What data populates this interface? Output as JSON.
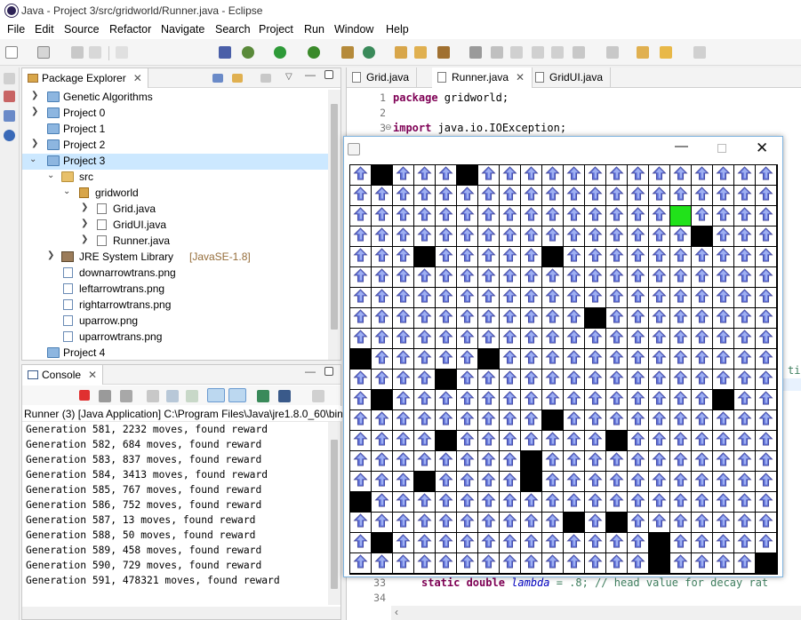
{
  "window_title": "Java - Project 3/src/gridworld/Runner.java - Eclipse",
  "menu": [
    "File",
    "Edit",
    "Source",
    "Refactor",
    "Navigate",
    "Search",
    "Project",
    "Run",
    "Window",
    "Help"
  ],
  "package_explorer": {
    "title": "Package Explorer",
    "items": [
      {
        "label": "Genetic Algorithms",
        "extra": ""
      },
      {
        "label": "Project 0",
        "extra": ""
      },
      {
        "label": "Project 1",
        "extra": ""
      },
      {
        "label": "Project 2",
        "extra": ""
      },
      {
        "label": "Project 3",
        "extra": ""
      },
      {
        "label": "src",
        "extra": ""
      },
      {
        "label": "gridworld",
        "extra": ""
      },
      {
        "label": "Grid.java",
        "extra": ""
      },
      {
        "label": "GridUI.java",
        "extra": ""
      },
      {
        "label": "Runner.java",
        "extra": ""
      },
      {
        "label": "JRE System Library",
        "extra": "[JavaSE-1.8]"
      },
      {
        "label": "downarrowtrans.png",
        "extra": ""
      },
      {
        "label": "leftarrowtrans.png",
        "extra": ""
      },
      {
        "label": "rightarrowtrans.png",
        "extra": ""
      },
      {
        "label": "uparrow.png",
        "extra": ""
      },
      {
        "label": "uparrowtrans.png",
        "extra": ""
      },
      {
        "label": "Project 4",
        "extra": ""
      }
    ]
  },
  "console": {
    "title": "Console",
    "subtitle": "Runner (3) [Java Application] C:\\Program Files\\Java\\jre1.8.0_60\\bin\\",
    "lines": [
      "Generation 581, 2232 moves, found reward",
      "Generation 582, 684 moves, found reward",
      "Generation 583, 837 moves, found reward",
      "Generation 584, 3413 moves, found reward",
      "Generation 585, 767 moves, found reward",
      "Generation 586, 752 moves, found reward",
      "Generation 587, 13 moves, found reward",
      "Generation 588, 50 moves, found reward",
      "Generation 589, 458 moves, found reward",
      "Generation 590, 729 moves, found reward",
      "Generation 591, 478321 moves, found reward"
    ]
  },
  "editor": {
    "tabs": [
      "Grid.java",
      "Runner.java",
      "GridUI.java"
    ],
    "active_tab": 1,
    "lines": [
      {
        "num": "1",
        "kw": "package",
        "text": " gridworld;"
      },
      {
        "num": "2",
        "kw": "",
        "text": ""
      },
      {
        "num": "3",
        "kw": "import",
        "text": " java.io.IOException;"
      }
    ],
    "tail_num_33": "33",
    "tail_kw_33": "static double",
    "tail_var_33": " lambda",
    "tail_text_33": " = .8; // head value for decay rat",
    "tail_num_34": "34",
    "partial_right": "ti"
  },
  "grid": {
    "cols": 20,
    "rows": 20,
    "black_cells": [
      [
        0,
        1
      ],
      [
        0,
        5
      ],
      [
        3,
        16
      ],
      [
        4,
        3
      ],
      [
        4,
        9
      ],
      [
        7,
        11
      ],
      [
        9,
        0
      ],
      [
        9,
        6
      ],
      [
        10,
        4
      ],
      [
        11,
        1
      ],
      [
        11,
        17
      ],
      [
        12,
        9
      ],
      [
        13,
        4
      ],
      [
        13,
        12
      ],
      [
        14,
        8
      ],
      [
        15,
        3
      ],
      [
        15,
        8
      ],
      [
        16,
        0
      ],
      [
        17,
        10
      ],
      [
        17,
        12
      ],
      [
        18,
        1
      ],
      [
        18,
        14
      ],
      [
        19,
        14
      ],
      [
        19,
        19
      ]
    ],
    "green_cells": [
      [
        2,
        15
      ]
    ],
    "arrow_icon": "up-arrow-icon",
    "colors": {
      "wall": "#000000",
      "goal": "#21e21a",
      "arrow": "#5d6fd6"
    }
  }
}
